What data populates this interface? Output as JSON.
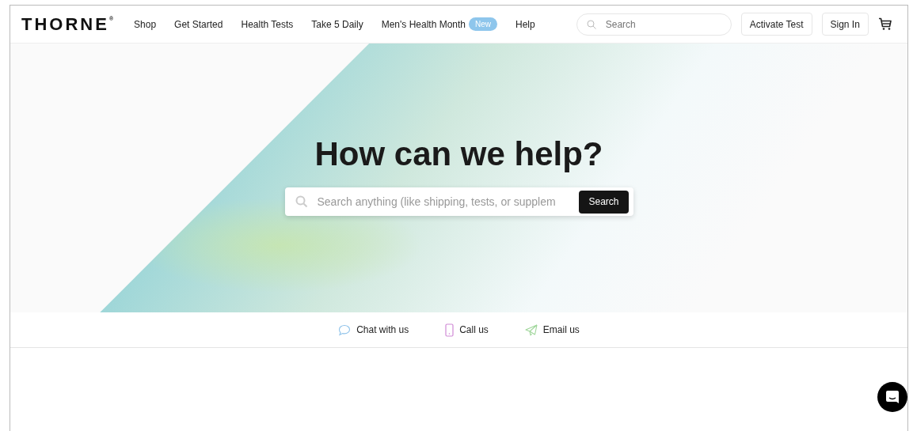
{
  "header": {
    "logo": "THORNE",
    "logo_mark": "®",
    "nav": [
      {
        "label": "Shop"
      },
      {
        "label": "Get Started"
      },
      {
        "label": "Health Tests"
      },
      {
        "label": "Take 5 Daily"
      },
      {
        "label": "Men's Health Month",
        "badge": "New"
      },
      {
        "label": "Help"
      }
    ],
    "search": {
      "placeholder": "Search"
    },
    "buttons": [
      "Activate Test",
      "Sign In"
    ]
  },
  "hero": {
    "title": "How can we help?",
    "search": {
      "placeholder": "Search anything (like shipping, tests, or supplem",
      "button": "Search"
    }
  },
  "contact": [
    {
      "kind": "chat",
      "label": "Chat with us"
    },
    {
      "kind": "call",
      "label": "Call us"
    },
    {
      "kind": "email",
      "label": "Email us"
    }
  ]
}
